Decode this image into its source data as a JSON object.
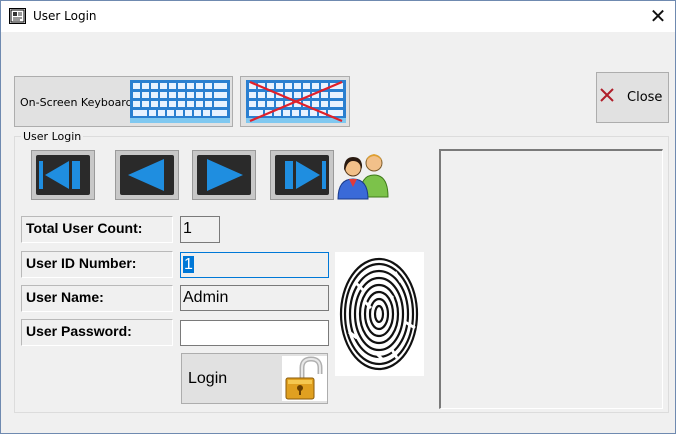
{
  "window": {
    "title": "User Login",
    "close_glyph": "✕"
  },
  "toolbar": {
    "keyboard_label": "On-Screen Keyboard",
    "close_label": "Close"
  },
  "group": {
    "label": "User Login"
  },
  "nav": {
    "icons": [
      "skip-to-first-icon",
      "previous-icon",
      "next-icon",
      "skip-to-last-icon"
    ]
  },
  "fields": {
    "total_user_count_label": "Total User Count:",
    "total_user_count_value": "1",
    "user_id_label": "User ID Number:",
    "user_id_value": "1",
    "user_name_label": "User Name:",
    "user_name_value": "Admin",
    "user_password_label": "User Password:",
    "user_password_value": ""
  },
  "login": {
    "label": "Login"
  },
  "colors": {
    "nav_arrow": "#1f8ee0",
    "selection": "#0078d7"
  }
}
